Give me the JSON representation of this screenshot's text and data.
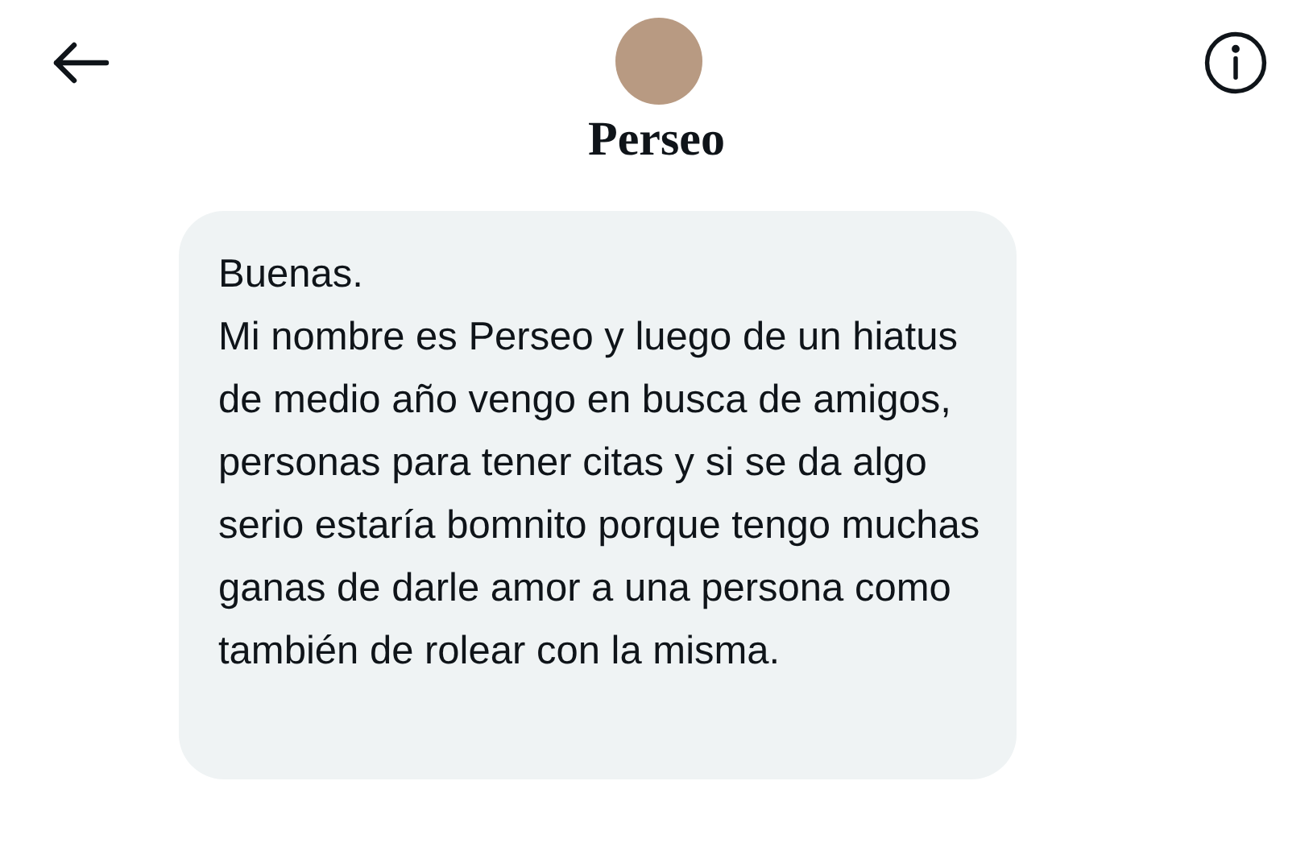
{
  "header": {
    "name": "Perseo"
  },
  "message": {
    "text": "Buenas.\nMi nombre es Perseo y luego de un hiatus de medio año vengo en busca de amigos, personas para tener citas y si se da algo serio estaría bomnito porque tengo muchas ganas de darle amor a una persona como también de rolear con la misma."
  }
}
